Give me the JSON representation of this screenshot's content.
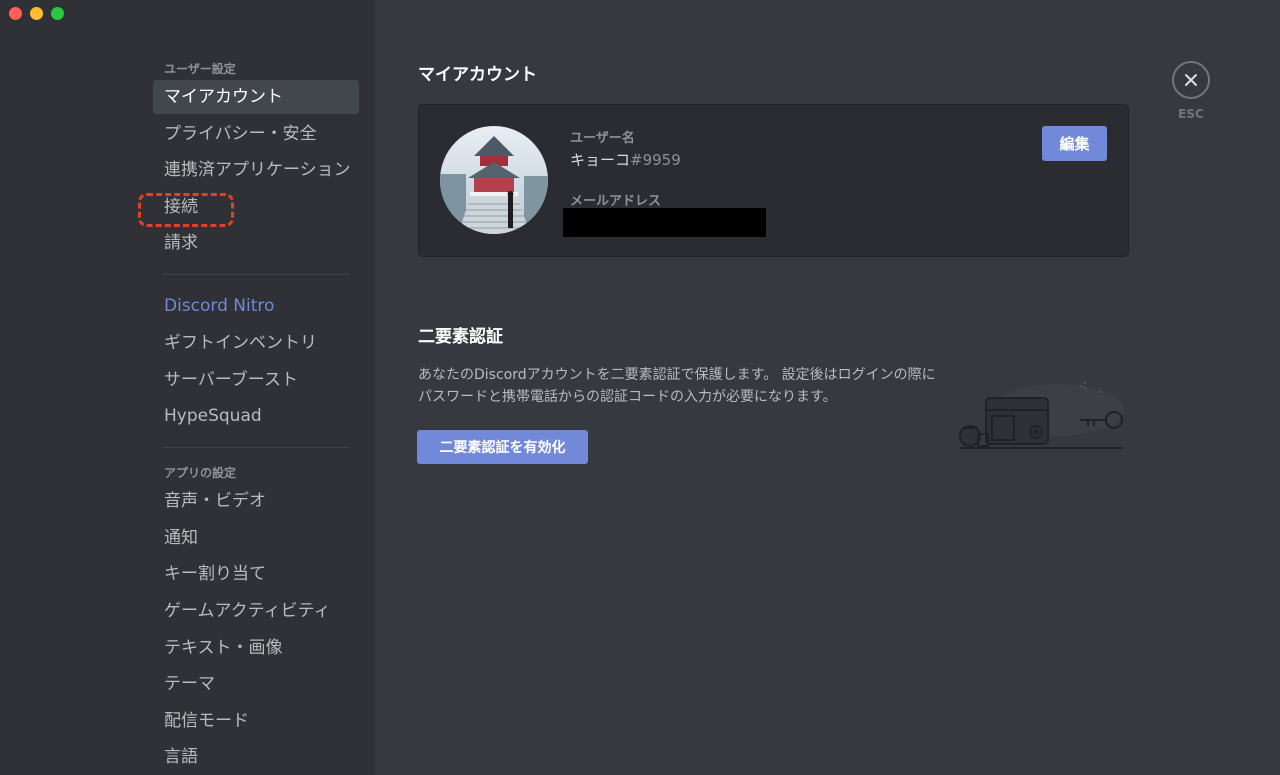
{
  "colors": {
    "accent": "#7289da",
    "sidebar_bg": "#2f3136",
    "main_bg": "#36393f",
    "highlight": "#e0431f"
  },
  "window": {
    "controls": [
      "close",
      "minimize",
      "zoom"
    ]
  },
  "sidebar": {
    "user_settings_header": "ユーザー設定",
    "user_items": [
      {
        "label": "マイアカウント",
        "selected": true
      },
      {
        "label": "プライバシー・安全"
      },
      {
        "label": "連携済アプリケーション"
      },
      {
        "label": "接続",
        "highlighted": true
      },
      {
        "label": "請求"
      }
    ],
    "nitro_items": [
      {
        "label": "Discord Nitro"
      },
      {
        "label": "ギフトインベントリ"
      },
      {
        "label": "サーバーブースト"
      },
      {
        "label": "HypeSquad"
      }
    ],
    "app_settings_header": "アプリの設定",
    "app_items": [
      {
        "label": "音声・ビデオ"
      },
      {
        "label": "通知"
      },
      {
        "label": "キー割り当て"
      },
      {
        "label": "ゲームアクティビティ"
      },
      {
        "label": "テキスト・画像"
      },
      {
        "label": "テーマ"
      },
      {
        "label": "配信モード"
      },
      {
        "label": "言語"
      }
    ]
  },
  "main": {
    "my_account_title": "マイアカウント",
    "account": {
      "username_label": "ユーザー名",
      "username": "キョーコ",
      "discriminator": "#9959",
      "email_label": "メールアドレス",
      "edit_label": "編集"
    },
    "two_factor": {
      "title": "二要素認証",
      "description": "あなたのDiscordアカウントを二要素認証で保護します。 設定後はログインの際に パスワードと携帯電話からの認証コードの入力が必要になります。",
      "enable_label": "二要素認証を有効化"
    },
    "close_label": "ESC"
  }
}
